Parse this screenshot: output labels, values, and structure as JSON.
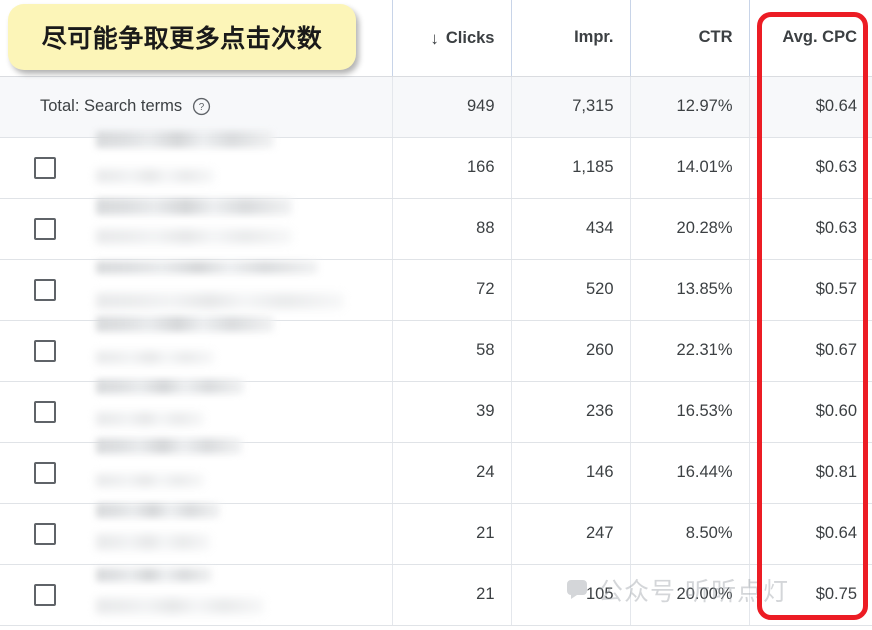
{
  "callout": {
    "text": "尽可能争取更多点击次数",
    "bg_color": "#fcf5b8"
  },
  "highlight": {
    "color": "#ec1c24",
    "target_column": "Avg. CPC"
  },
  "watermark": {
    "icon": "speech-bubble-icon",
    "text": "公众号 听昕点灯"
  },
  "table": {
    "columns": [
      {
        "label": "",
        "key": "name"
      },
      {
        "label": "Clicks",
        "key": "clicks",
        "sorted": true,
        "sort_icon": "↓"
      },
      {
        "label": "Impr.",
        "key": "impr"
      },
      {
        "label": "CTR",
        "key": "ctr"
      },
      {
        "label": "Avg. CPC",
        "key": "cpc"
      }
    ],
    "total_row": {
      "label": "Total: Search terms",
      "help_icon": "help-circle-icon",
      "clicks": "949",
      "impr": "7,315",
      "ctr": "12.97%",
      "cpc": "$0.64"
    },
    "rows": [
      {
        "name": "",
        "clicks": "166",
        "impr": "1,185",
        "ctr": "14.01%",
        "cpc": "$0.63",
        "checked": false
      },
      {
        "name": "",
        "clicks": "88",
        "impr": "434",
        "ctr": "20.28%",
        "cpc": "$0.63",
        "checked": false
      },
      {
        "name": "",
        "clicks": "72",
        "impr": "520",
        "ctr": "13.85%",
        "cpc": "$0.57",
        "checked": false
      },
      {
        "name": "",
        "clicks": "58",
        "impr": "260",
        "ctr": "22.31%",
        "cpc": "$0.67",
        "checked": false
      },
      {
        "name": "",
        "clicks": "39",
        "impr": "236",
        "ctr": "16.53%",
        "cpc": "$0.60",
        "checked": false
      },
      {
        "name": "",
        "clicks": "24",
        "impr": "146",
        "ctr": "16.44%",
        "cpc": "$0.81",
        "checked": false
      },
      {
        "name": "",
        "clicks": "21",
        "impr": "247",
        "ctr": "8.50%",
        "cpc": "$0.64",
        "checked": false
      },
      {
        "name": "",
        "clicks": "21",
        "impr": "105",
        "ctr": "20.00%",
        "cpc": "$0.75",
        "checked": false
      }
    ]
  }
}
